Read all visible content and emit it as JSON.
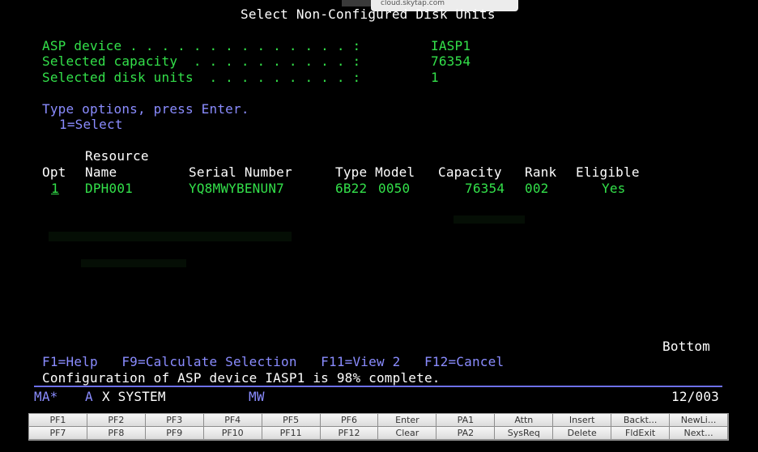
{
  "browser_hint": {
    "url": "cloud.skytap.com"
  },
  "screen": {
    "title": "Select Non-Configured Disk Units",
    "fields": [
      {
        "label": "ASP device . . . . . . . . . . . . . . :",
        "value": "IASP1"
      },
      {
        "label": "Selected capacity  . . . . . . . . . . :",
        "value": "76354"
      },
      {
        "label": "Selected disk units  . . . . . . . . . :",
        "value": "1"
      }
    ],
    "instructions": "Type options, press Enter.",
    "option_legend": "1=Select",
    "headers": {
      "resource": "Resource",
      "opt": "Opt",
      "name": "Name",
      "serial": "Serial Number",
      "type_model": "Type Model",
      "capacity": "Capacity",
      "rank": "Rank",
      "eligible": "Eligible"
    },
    "rows": [
      {
        "opt": "1",
        "name": "DPH001",
        "serial": "YQ8MWYBENUN7",
        "type": "6B22",
        "model": "0050",
        "capacity": "76354",
        "rank": "002",
        "eligible": "Yes"
      }
    ],
    "more": "Bottom",
    "function_keys": "F1=Help   F9=Calculate Selection   F11=View 2   F12=Cancel",
    "message": "Configuration of ASP device IASP1 is 98% complete."
  },
  "oia": {
    "mode": "MA*",
    "a": "A",
    "x_system": "X SYSTEM",
    "mw": "MW",
    "cursor": "12/003"
  },
  "keypad": [
    [
      "PF1",
      "PF2",
      "PF3",
      "PF4",
      "PF5",
      "PF6",
      "Enter",
      "PA1",
      "Attn",
      "Insert",
      "Backt...",
      "NewLi..."
    ],
    [
      "PF7",
      "PF8",
      "PF9",
      "PF10",
      "PF11",
      "PF12",
      "Clear",
      "PA2",
      "SysReq",
      "Delete",
      "FldExit",
      "Next..."
    ]
  ],
  "colors": {
    "field_green": "#33e04a",
    "instruction_blue": "#8a8cff",
    "text_white": "#ffffff",
    "oia_line": "#6d6fe8"
  }
}
